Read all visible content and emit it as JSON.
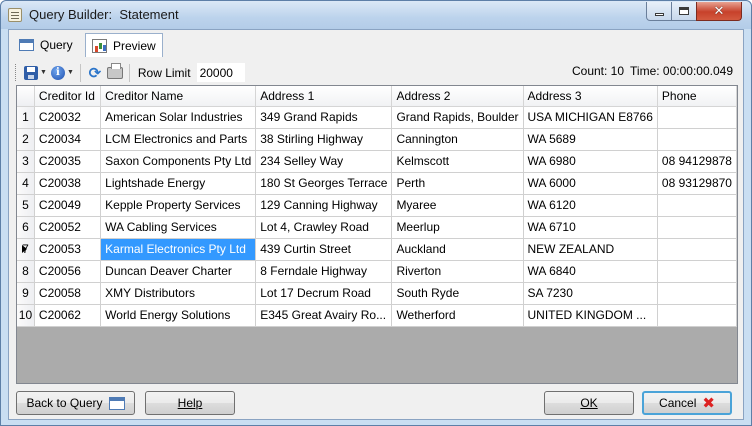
{
  "window": {
    "title": "Query Builder:  Statement"
  },
  "tabs": [
    {
      "label": "Query"
    },
    {
      "label": "Preview"
    }
  ],
  "toolbar": {
    "row_limit_label": "Row Limit",
    "row_limit_value": "20000",
    "count_text": "Count: 10",
    "time_text": "Time: 00:00:00.049"
  },
  "grid": {
    "columns": [
      "Creditor Id",
      "Creditor Name",
      "Address 1",
      "Address 2",
      "Address 3",
      "Phone"
    ],
    "current_row": 7,
    "selected_cell": {
      "row": 7,
      "column": "Creditor Name"
    },
    "rows": [
      {
        "num": "1",
        "cells": [
          "C20032",
          "American Solar Industries",
          "349 Grand Rapids",
          "Grand Rapids, Boulder",
          "USA MICHIGAN E8766",
          ""
        ]
      },
      {
        "num": "2",
        "cells": [
          "C20034",
          "LCM Electronics and Parts",
          "38 Stirling Highway",
          "Cannington",
          "WA 5689",
          ""
        ]
      },
      {
        "num": "3",
        "cells": [
          "C20035",
          "Saxon Components Pty Ltd",
          "234 Selley Way",
          "Kelmscott",
          "WA 6980",
          "08 94129878"
        ]
      },
      {
        "num": "4",
        "cells": [
          "C20038",
          "Lightshade Energy",
          "180 St Georges Terrace",
          "Perth",
          "WA 6000",
          "08 93129870"
        ]
      },
      {
        "num": "5",
        "cells": [
          "C20049",
          "Kepple Property Services",
          "129 Canning Highway",
          "Myaree",
          "WA 6120",
          ""
        ]
      },
      {
        "num": "6",
        "cells": [
          "C20052",
          "WA Cabling Services",
          "Lot 4, Crawley Road",
          "Meerlup",
          "WA 6710",
          ""
        ]
      },
      {
        "num": "7",
        "cells": [
          "C20053",
          "Karmal Electronics Pty Ltd",
          "439 Curtin Street",
          "Auckland",
          "NEW ZEALAND",
          ""
        ]
      },
      {
        "num": "8",
        "cells": [
          "C20056",
          "Duncan Deaver Charter",
          "8 Ferndale Highway",
          "Riverton",
          "WA 6840",
          ""
        ]
      },
      {
        "num": "9",
        "cells": [
          "C20058",
          "XMY Distributors",
          "Lot 17 Decrum Road",
          "South Ryde",
          "SA 7230",
          ""
        ]
      },
      {
        "num": "10",
        "cells": [
          "C20062",
          "World Energy Solutions",
          "E345 Great Avairy Ro...",
          "Wetherford",
          "UNITED KINGDOM ...",
          ""
        ]
      }
    ]
  },
  "footer": {
    "back_label": "Back to Query",
    "help_label": "Help",
    "ok_label": "OK",
    "cancel_label": "Cancel"
  }
}
